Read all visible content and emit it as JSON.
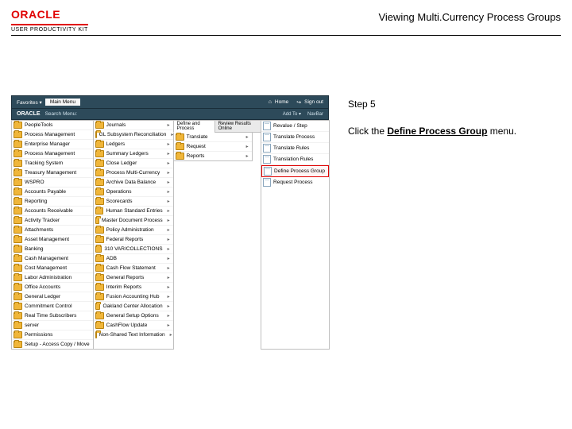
{
  "header": {
    "brand": "ORACLE",
    "subbrand": "USER PRODUCTIVITY KIT",
    "title": "Viewing Multi.Currency Process Groups"
  },
  "instruction": {
    "step_label": "Step 5",
    "click_prefix": "Click the ",
    "click_target": "Define Process Group",
    "click_suffix": " menu."
  },
  "topbar": {
    "menu": "Favorites ▾",
    "tab": "Main Menu",
    "home": "Home",
    "signout": "Sign out"
  },
  "oraclebar": {
    "logo": "ORACLE",
    "label": "Search Menu:",
    "nav1": "Add To ▾",
    "nav2": "NavBar"
  },
  "col0": [
    "PeopleTools",
    "Process Management",
    "Enterprise Manager",
    "Process Management",
    "Tracking System",
    "Treasury Management",
    "WSPRO",
    "Accounts Payable",
    "Reporting",
    "Accounts Receivable",
    "Activity Tracker",
    "Attachments",
    "Asset Management",
    "Banking",
    "Cash Management",
    "Cost Management",
    "Labor Administration",
    "Office Accounts",
    "General Ledger",
    "Commitment Control",
    "Real Time Subscribers",
    "server",
    "Permissions",
    "Setup - Access Copy / Move"
  ],
  "col1": [
    "Journals",
    "GL Subsystem Reconciliation",
    "Ledgers",
    "Summary Ledgers",
    "Close Ledger",
    "Process Multi-Currency",
    "Archive Data Balance",
    "Operations",
    "Scorecards",
    "Human Standard Entries",
    "Master Document Process",
    "Policy Administration",
    "Federal Reports",
    "310 VAR/COLLECTIONS",
    "ADB",
    "Cash Flow Statement",
    "General Reports",
    "Interim Reports",
    "Fusion Accounting Hub",
    "Oakland Center Allocation",
    "General Setup Options",
    "CashFlow Update",
    "Non-Shared Text Information"
  ],
  "col2_tabs": {
    "a": "Define and Process",
    "b": "Review Results Online"
  },
  "col2": [
    "Translate",
    "Request",
    "Reports"
  ],
  "col3": [
    "Revalue / Step",
    "Translate Process",
    "Translate Rules",
    "Translation Rules",
    "Define Process Group",
    "Request Process"
  ],
  "highlight_index": 4
}
